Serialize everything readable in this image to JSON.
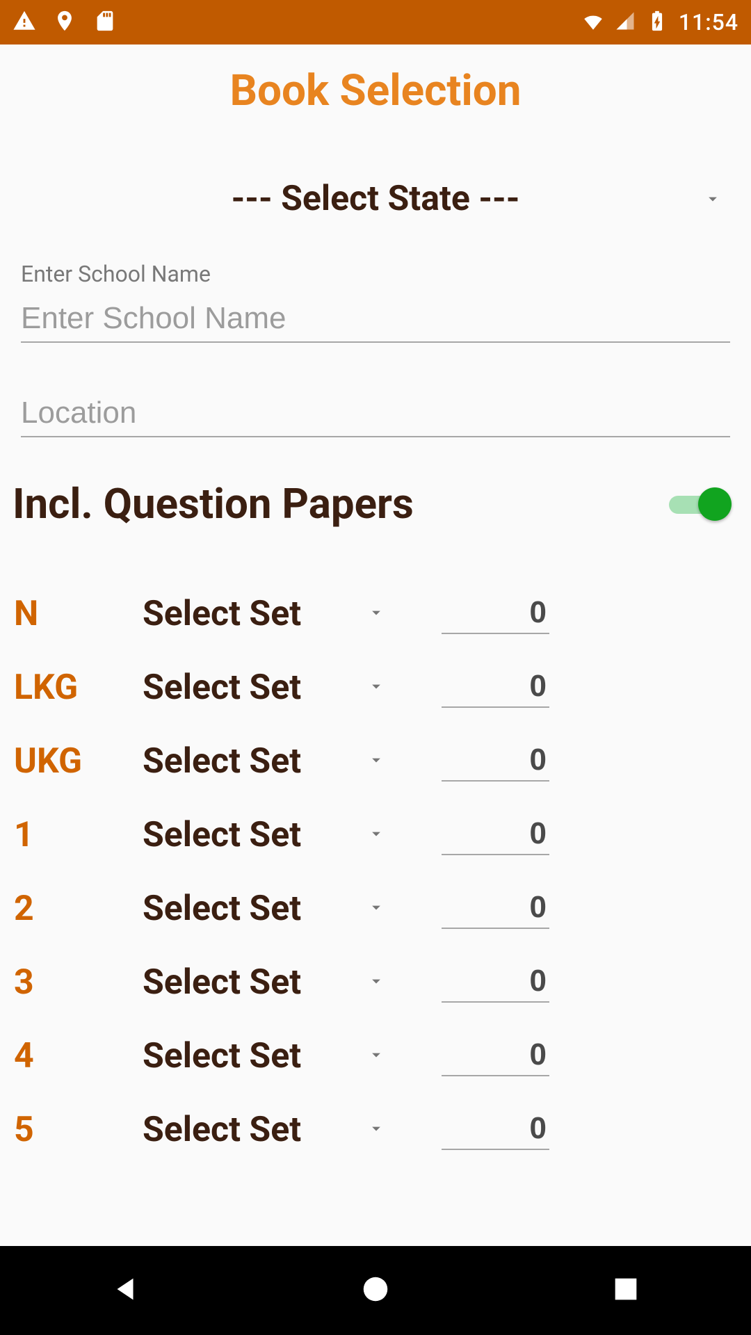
{
  "status_bar": {
    "time": "11:54"
  },
  "page_title": "Book Selection",
  "state_select": {
    "label": "--- Select State ---"
  },
  "school_name": {
    "label": "Enter School Name",
    "placeholder": "Enter School Name",
    "value": ""
  },
  "location": {
    "placeholder": "Location",
    "value": ""
  },
  "toggle": {
    "label": "Incl. Question Papers",
    "on": true
  },
  "select_set_label": "Select Set",
  "grades": [
    {
      "name": "N",
      "qty": "0"
    },
    {
      "name": "LKG",
      "qty": "0"
    },
    {
      "name": "UKG",
      "qty": "0"
    },
    {
      "name": "1",
      "qty": "0"
    },
    {
      "name": "2",
      "qty": "0"
    },
    {
      "name": "3",
      "qty": "0"
    },
    {
      "name": "4",
      "qty": "0"
    },
    {
      "name": "5",
      "qty": "0"
    }
  ]
}
